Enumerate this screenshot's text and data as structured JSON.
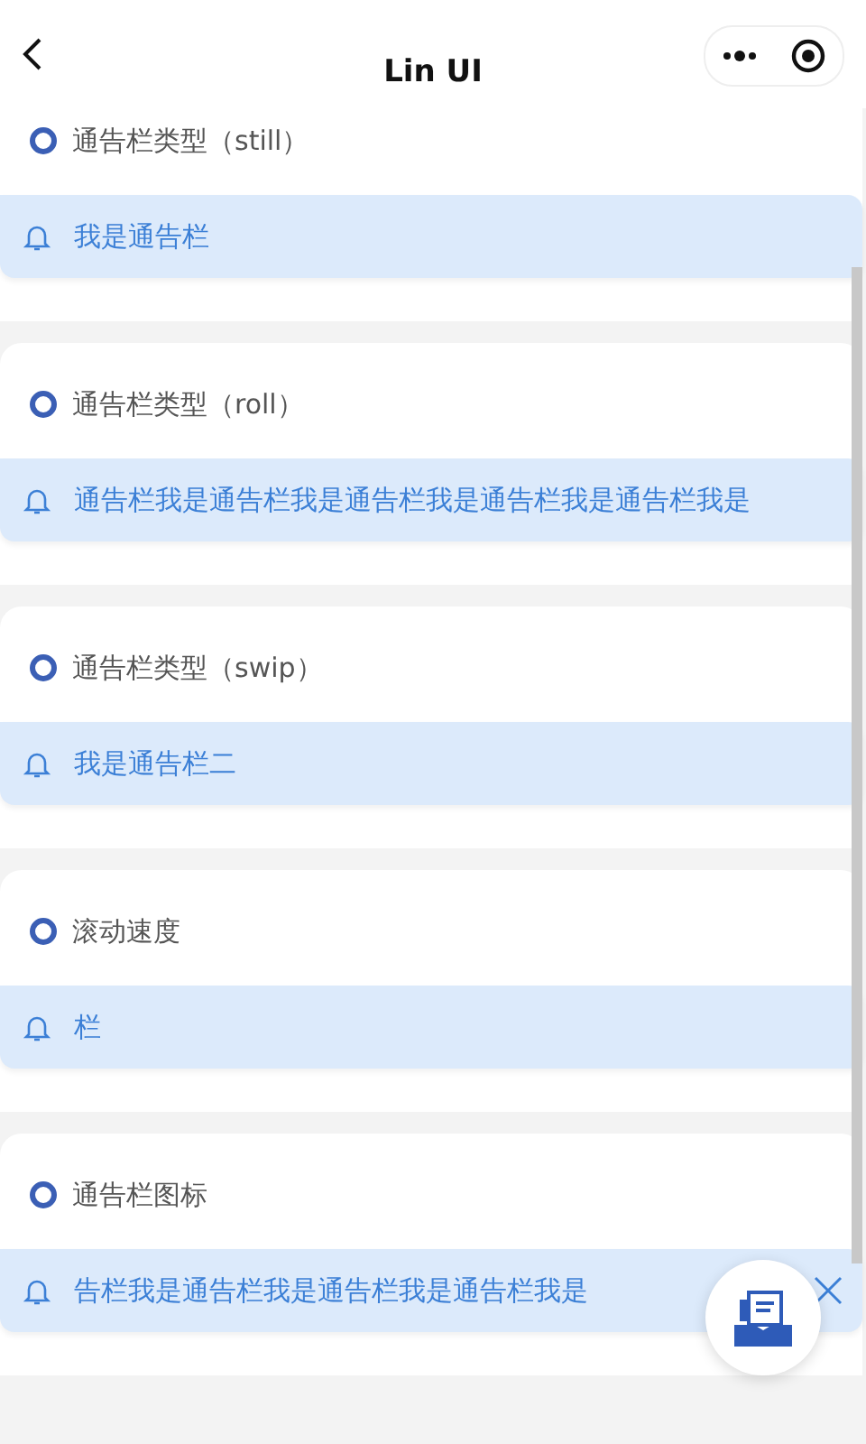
{
  "header": {
    "title": "Lin UI"
  },
  "sections": [
    {
      "title": "通告栏类型（still）",
      "notice": {
        "text": "我是通告栏",
        "closable": false
      }
    },
    {
      "title": "通告栏类型（roll）",
      "notice": {
        "text": "通告栏我是通告栏我是通告栏我是通告栏我是通告栏我是",
        "closable": false
      }
    },
    {
      "title": "通告栏类型（swip）",
      "notice": {
        "text": "我是通告栏二",
        "closable": false
      }
    },
    {
      "title": "滚动速度",
      "notice": {
        "text": "栏",
        "closable": false
      }
    },
    {
      "title": "通告栏图标",
      "notice": {
        "text": "告栏我是通告栏我是通告栏我是通告栏我是",
        "closable": true
      }
    }
  ]
}
